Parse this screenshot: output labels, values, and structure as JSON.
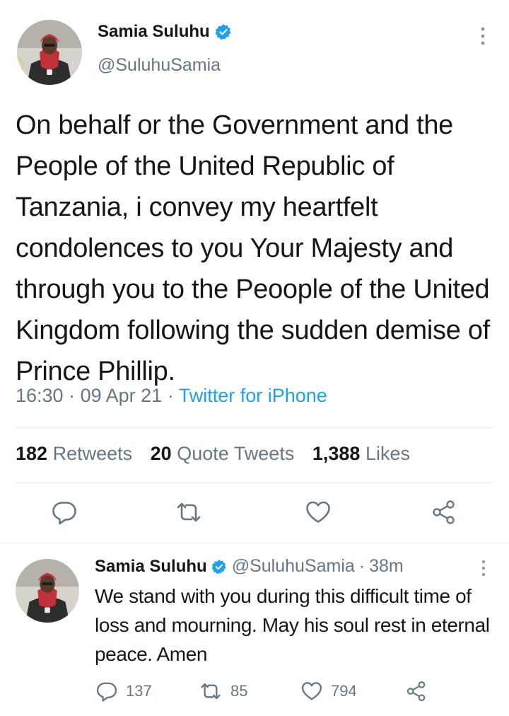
{
  "main_tweet": {
    "author_name": "Samia Suluhu",
    "author_handle": "@SuluhuSamia",
    "text": "On behalf or the Government and the People of the United Republic of Tanzania, i convey my heartfelt condolences to you Your Majesty and through you to the Peoople of the United Kingdom following the sudden demise of Prince Phillip.",
    "time": "16:30",
    "date": "09 Apr 21",
    "source": "Twitter for iPhone",
    "separator": "·",
    "stats": {
      "retweets_count": "182",
      "retweets_label": "Retweets",
      "quotes_count": "20",
      "quotes_label": "Quote Tweets",
      "likes_count": "1,388",
      "likes_label": "Likes"
    }
  },
  "reply_tweet": {
    "author_name": "Samia Suluhu",
    "author_handle": "@SuluhuSamia",
    "age": "38m",
    "separator": "·",
    "text": "We stand with you during this difficult time of loss and mourning. May his soul rest in eternal peace. Amen",
    "counts": {
      "replies": "137",
      "retweets": "85",
      "likes": "794"
    }
  },
  "icons": {
    "verified": "verified-badge-icon",
    "more": "more-vertical-icon",
    "reply": "reply-icon",
    "retweet": "retweet-icon",
    "like": "heart-icon",
    "share": "share-icon"
  },
  "colors": {
    "accent": "#1da1f2",
    "text": "#14171a",
    "secondary": "#657786",
    "divider": "#e1e8ed"
  }
}
